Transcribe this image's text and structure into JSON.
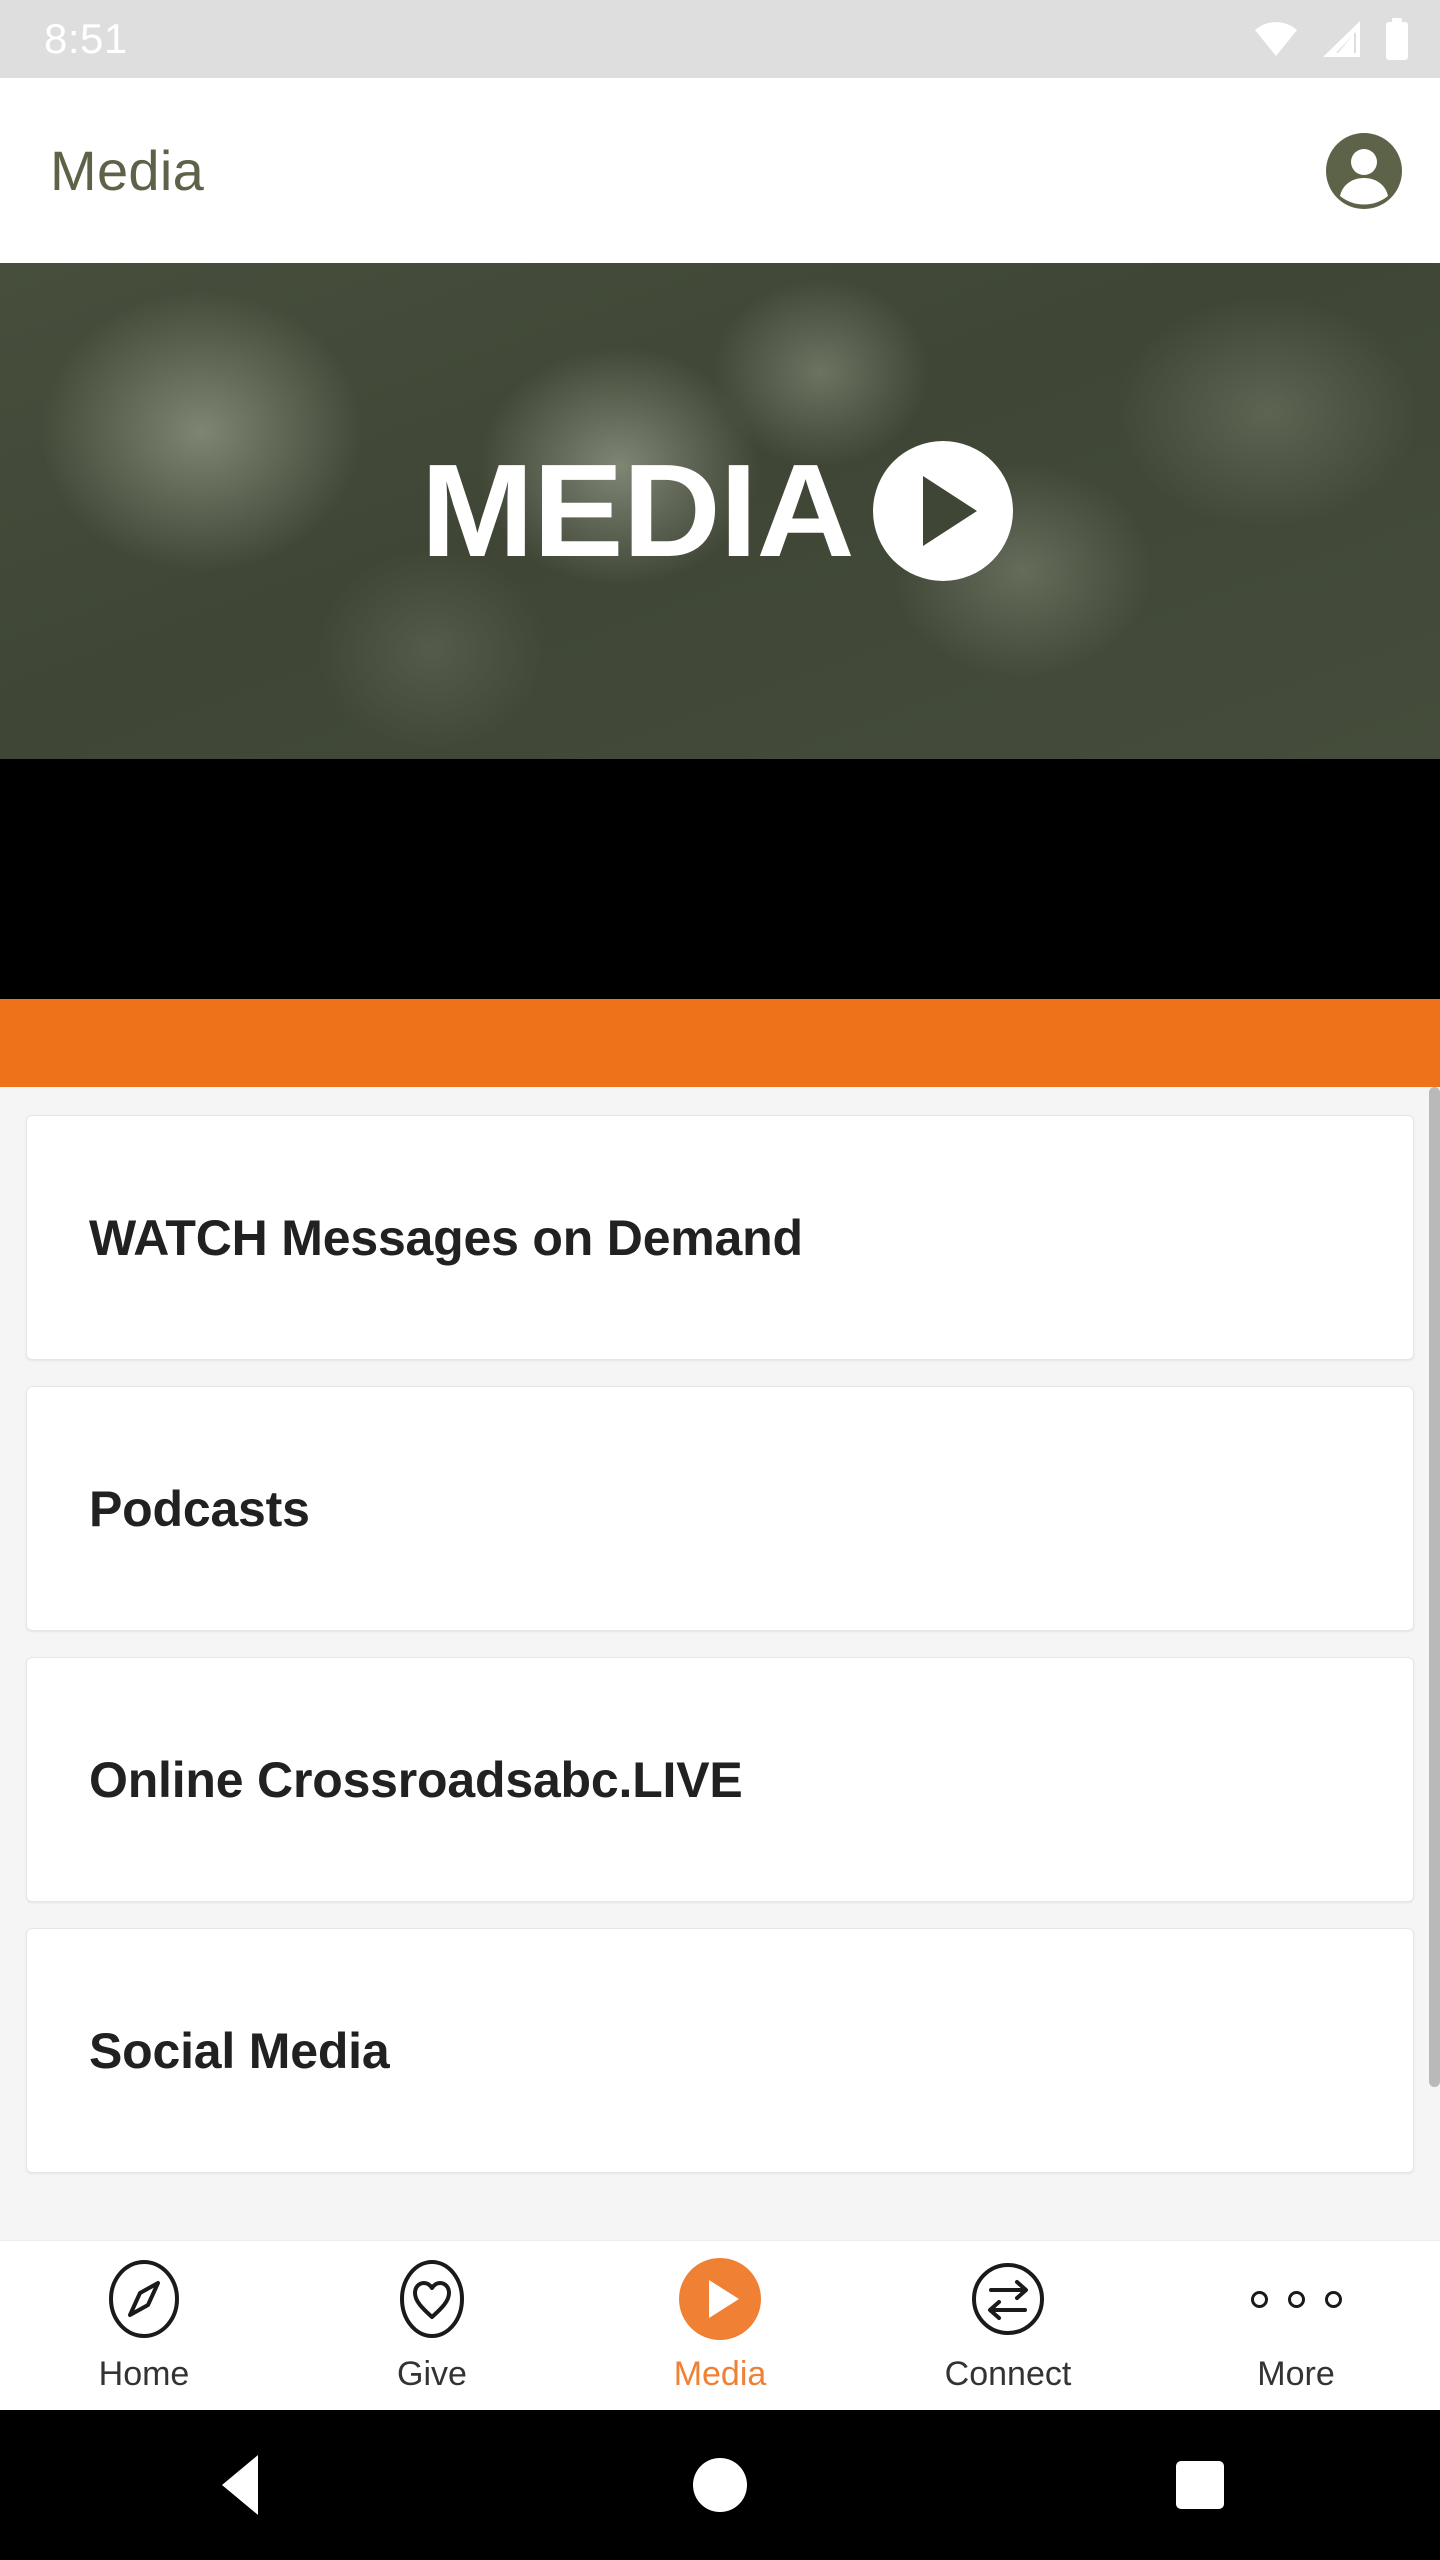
{
  "status_bar": {
    "time": "8:51",
    "icons": [
      "wifi-icon",
      "cell-signal-icon",
      "battery-icon"
    ],
    "background_color": "#dedede",
    "foreground_color": "#ffffff"
  },
  "app_bar": {
    "title": "Media",
    "title_color": "#5d6348",
    "avatar_icon": "account-avatar-icon"
  },
  "hero": {
    "word": "MEDIA",
    "play_icon": "play-icon",
    "background_color": "#424936"
  },
  "bars": {
    "black_color": "#000000",
    "orange_color": "#ee7219"
  },
  "list": {
    "items": [
      {
        "title": "WATCH Messages on Demand"
      },
      {
        "title": "Podcasts"
      },
      {
        "title": "Online Crossroadsabc.LIVE"
      },
      {
        "title": "Social Media"
      }
    ]
  },
  "tab_bar": {
    "active": "Media",
    "accent_color": "#f08033",
    "tabs": [
      {
        "label": "Home",
        "icon": "compass-icon"
      },
      {
        "label": "Give",
        "icon": "heart-icon"
      },
      {
        "label": "Media",
        "icon": "play-circle-icon"
      },
      {
        "label": "Connect",
        "icon": "exchange-arrows-icon"
      },
      {
        "label": "More",
        "icon": "three-dots-icon"
      }
    ]
  },
  "android_nav": {
    "buttons": [
      {
        "name": "back-button",
        "icon": "triangle-back-icon"
      },
      {
        "name": "home-button",
        "icon": "circle-home-icon"
      },
      {
        "name": "recents-button",
        "icon": "square-recents-icon"
      }
    ]
  }
}
